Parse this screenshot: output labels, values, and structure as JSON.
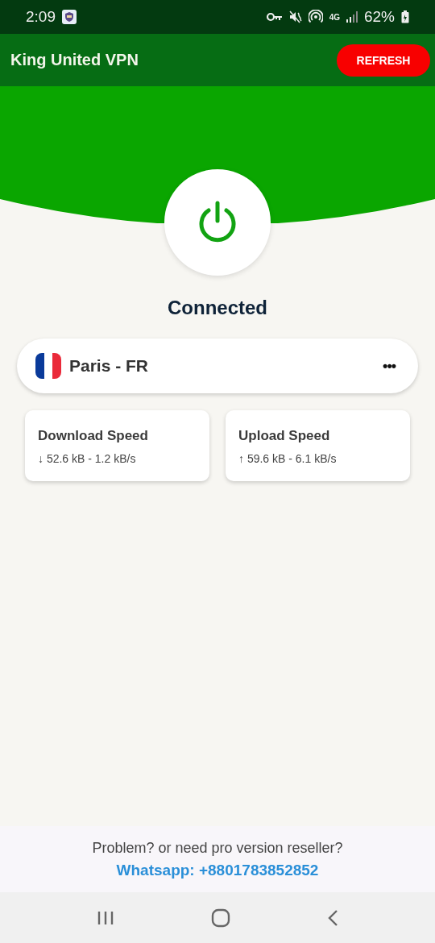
{
  "status_bar": {
    "time": "2:09",
    "network": "4G",
    "battery": "62%"
  },
  "app_bar": {
    "title": "King United VPN",
    "action": "REFRESH"
  },
  "connection": {
    "connected": true,
    "status": "Connected"
  },
  "location": {
    "name": "Paris - FR",
    "more": "•••"
  },
  "stats": [
    {
      "label": "Download Speed",
      "reading": "↓ 52.6 kB - 1.2 kB/s"
    },
    {
      "label": "Upload Speed",
      "reading": "↑ 59.6 kB - 6.1 kB/s"
    }
  ],
  "footer": {
    "text": "Problem? or need pro version reseller?",
    "link": "Whatsapp: +8801783852852"
  }
}
